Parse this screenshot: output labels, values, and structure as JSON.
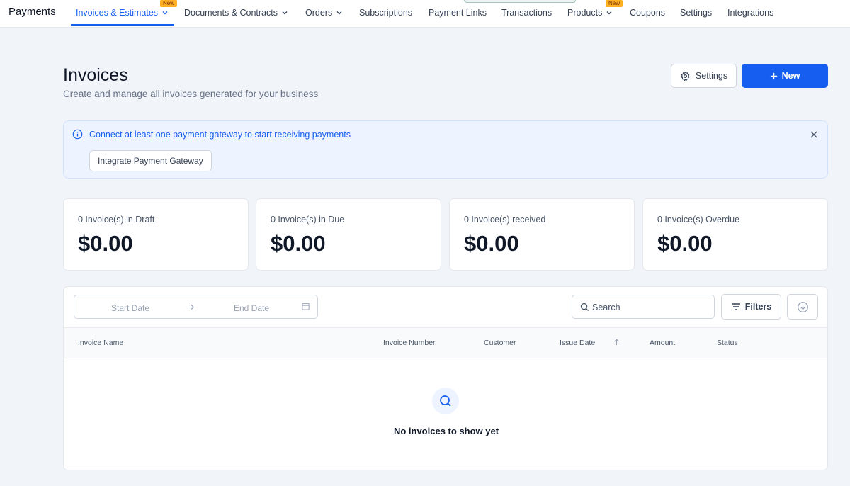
{
  "app": {
    "title": "Payments"
  },
  "nav": {
    "items": [
      {
        "label": "Invoices & Estimates",
        "badge": "New"
      },
      {
        "label": "Documents & Contracts"
      },
      {
        "label": "Orders"
      },
      {
        "label": "Subscriptions"
      },
      {
        "label": "Payment Links"
      },
      {
        "label": "Transactions"
      },
      {
        "label": "Products",
        "badge": "New"
      },
      {
        "label": "Coupons"
      },
      {
        "label": "Settings"
      },
      {
        "label": "Integrations"
      }
    ]
  },
  "header": {
    "title": "Invoices",
    "subtitle": "Create and manage all invoices generated for your business",
    "settings_label": "Settings",
    "new_label": "New"
  },
  "alert": {
    "message": "Connect at least one payment gateway to start receiving payments",
    "button_label": "Integrate Payment Gateway"
  },
  "stats": [
    {
      "label": "0 Invoice(s) in Draft",
      "value": "$0.00"
    },
    {
      "label": "0 Invoice(s) in Due",
      "value": "$0.00"
    },
    {
      "label": "0 Invoice(s) received",
      "value": "$0.00"
    },
    {
      "label": "0 Invoice(s) Overdue",
      "value": "$0.00"
    }
  ],
  "table": {
    "date_start_placeholder": "Start Date",
    "date_end_placeholder": "End Date",
    "search_placeholder": "Search",
    "filters_label": "Filters",
    "columns": [
      "Invoice Name",
      "Invoice Number",
      "Customer",
      "Issue Date",
      "Amount",
      "Status"
    ],
    "empty_message": "No invoices to show yet"
  },
  "colors": {
    "primary": "#155eef",
    "alert_bg": "#eef4ff",
    "badge": "#fdb022",
    "page_bg": "#f1f5f9"
  }
}
